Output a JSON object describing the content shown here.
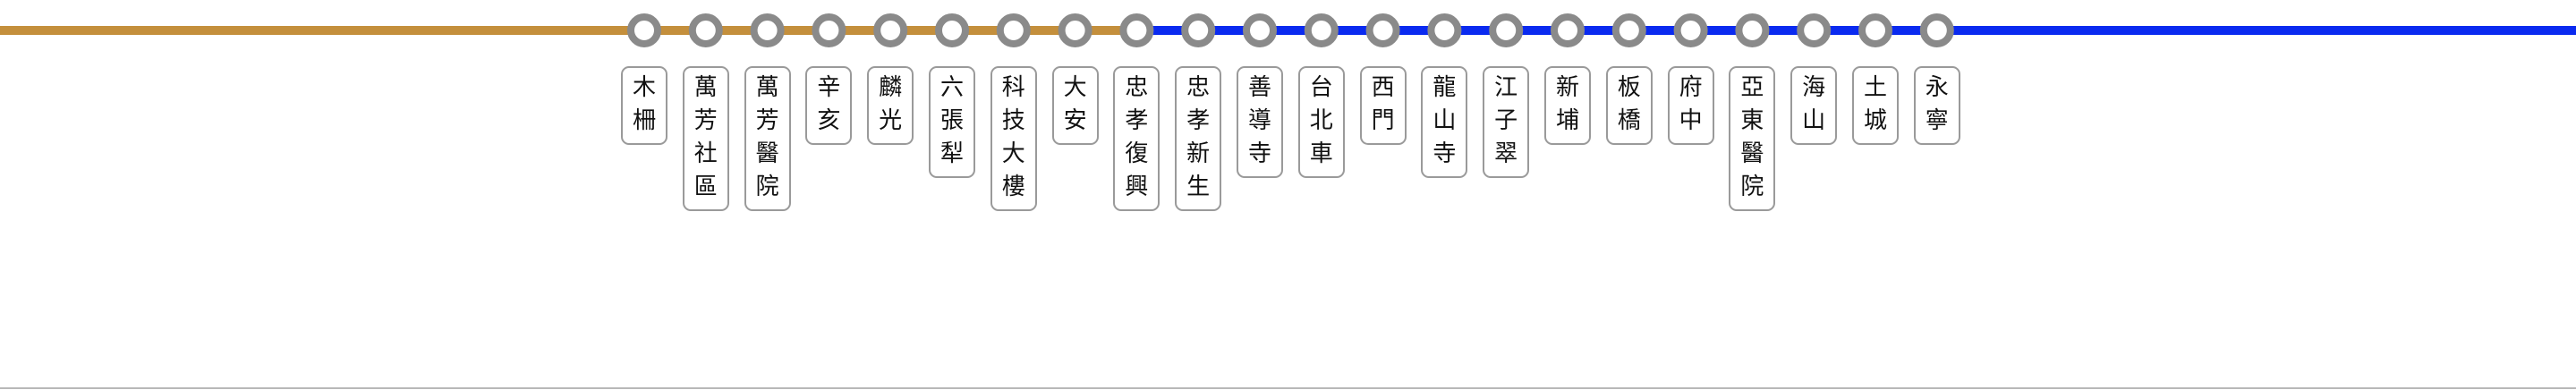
{
  "line": {
    "colors": {
      "tan": "#c48f3c",
      "blue": "#0a2af0",
      "station_ring": "#8a8a8a",
      "station_fill": "#ffffff"
    }
  },
  "stations": [
    {
      "name": "木柵",
      "segment": "tan"
    },
    {
      "name": "萬芳社區",
      "segment": "tan"
    },
    {
      "name": "萬芳醫院",
      "segment": "tan"
    },
    {
      "name": "辛亥",
      "segment": "tan"
    },
    {
      "name": "麟光",
      "segment": "tan"
    },
    {
      "name": "六張犁",
      "segment": "tan"
    },
    {
      "name": "科技大樓",
      "segment": "tan"
    },
    {
      "name": "大安",
      "segment": "tan"
    },
    {
      "name": "忠孝復興",
      "segment": "tan"
    },
    {
      "name": "忠孝新生",
      "segment": "blue"
    },
    {
      "name": "善導寺",
      "segment": "blue"
    },
    {
      "name": "台北車",
      "segment": "blue"
    },
    {
      "name": "西門",
      "segment": "blue"
    },
    {
      "name": "龍山寺",
      "segment": "blue"
    },
    {
      "name": "江子翠",
      "segment": "blue"
    },
    {
      "name": "新埔",
      "segment": "blue"
    },
    {
      "name": "板橋",
      "segment": "blue"
    },
    {
      "name": "府中",
      "segment": "blue"
    },
    {
      "name": "亞東醫院",
      "segment": "blue"
    },
    {
      "name": "海山",
      "segment": "blue"
    },
    {
      "name": "土城",
      "segment": "blue"
    },
    {
      "name": "永寧",
      "segment": "blue"
    }
  ]
}
